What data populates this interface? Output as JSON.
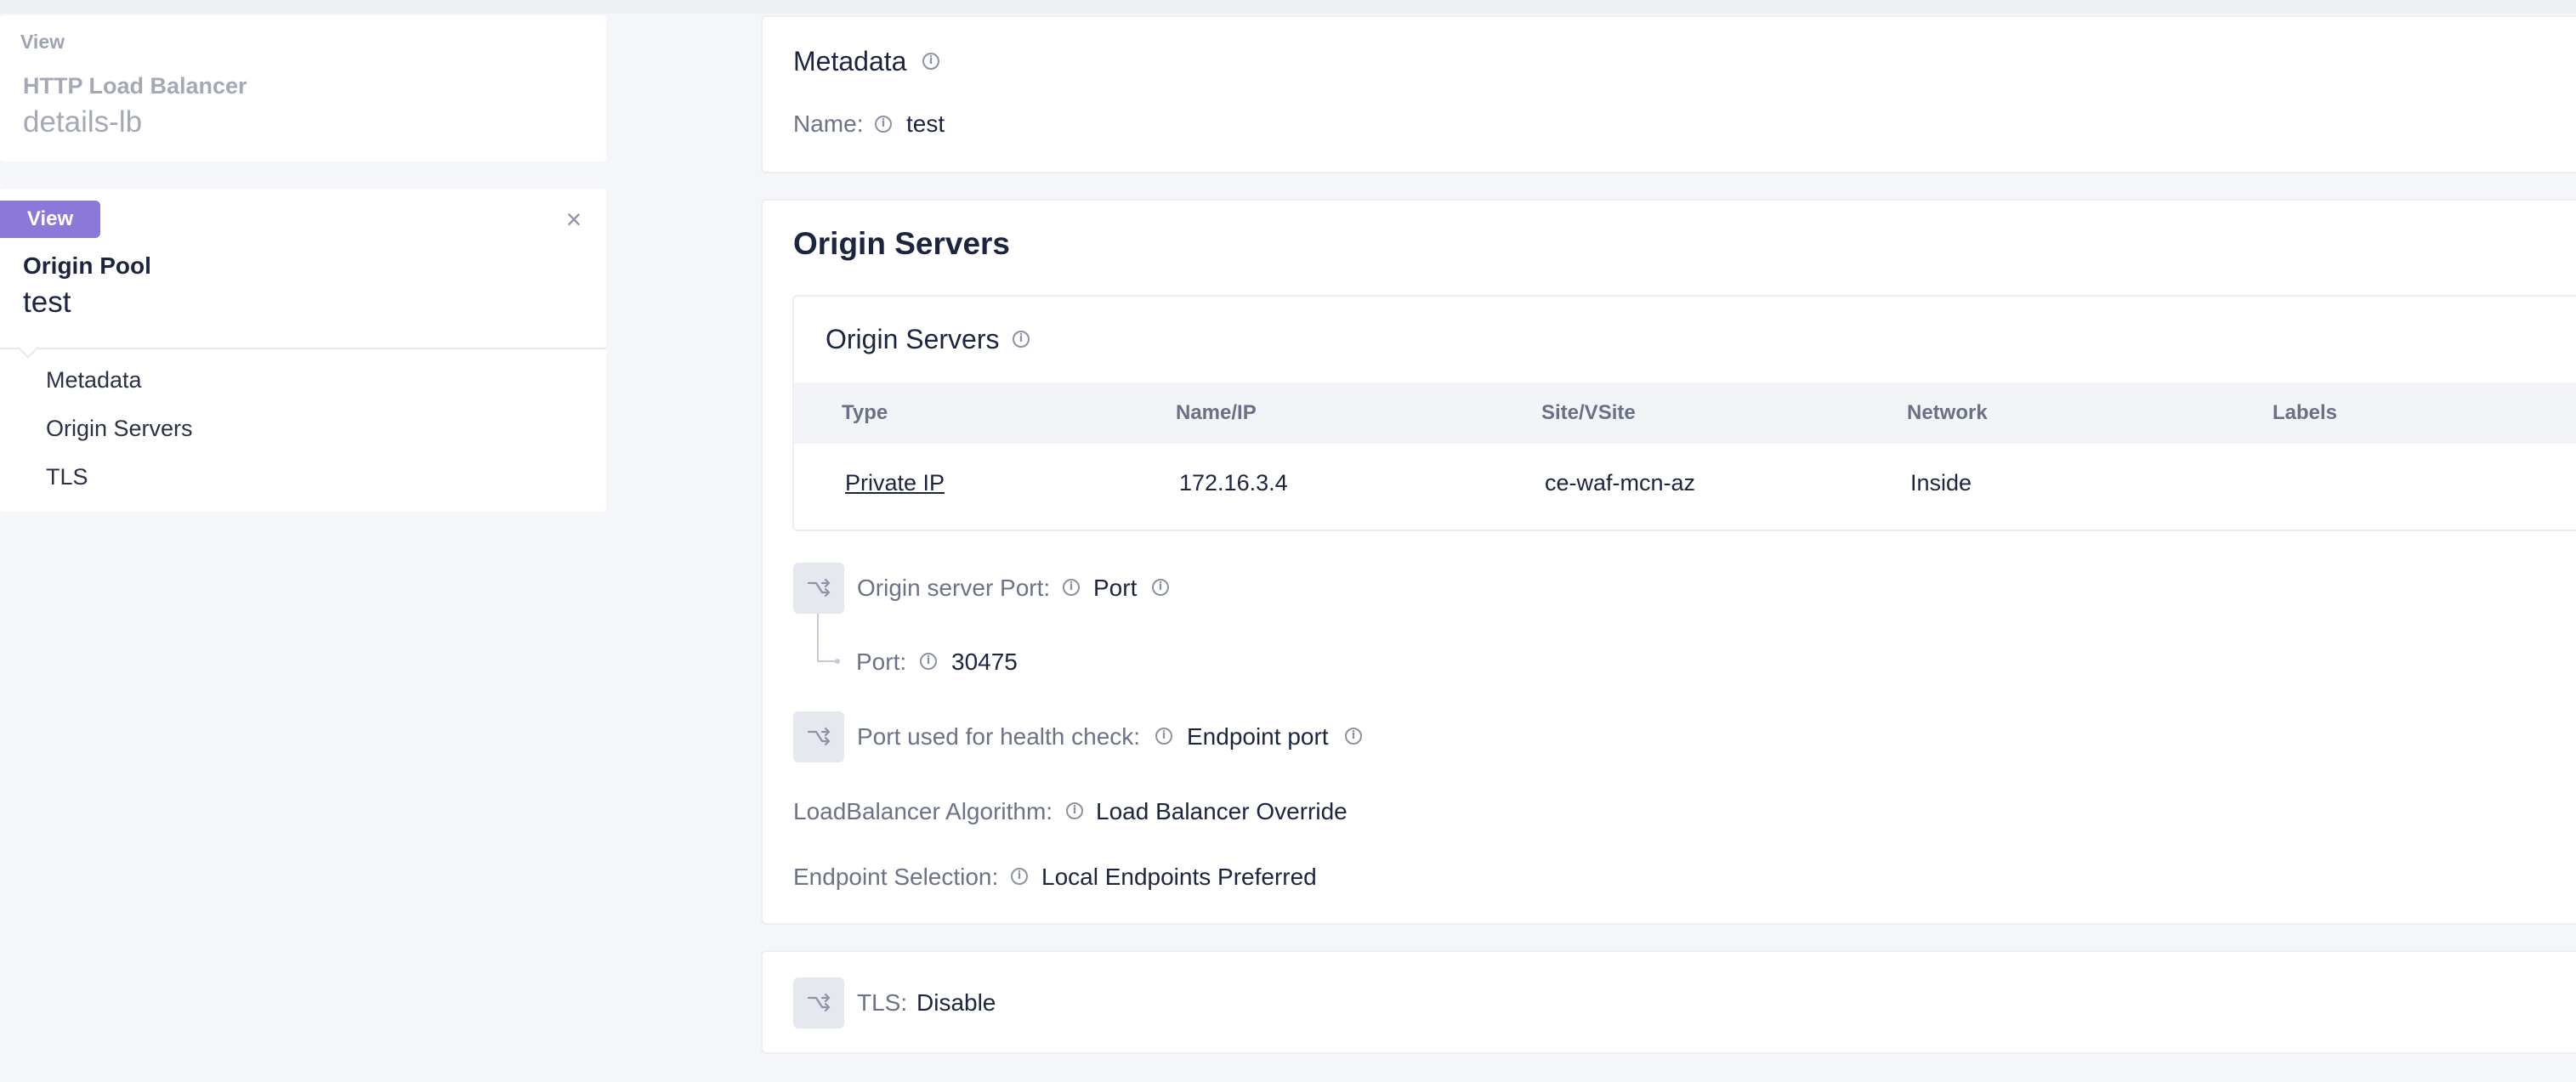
{
  "left": {
    "card1": {
      "view_label": "View",
      "object_type": "HTTP Load Balancer",
      "object_name": "details-lb"
    },
    "card2": {
      "view_badge": "View",
      "close_glyph": "×",
      "object_type": "Origin Pool",
      "object_name": "test",
      "nav": [
        "Metadata",
        "Origin Servers",
        "TLS"
      ]
    }
  },
  "metadata": {
    "title": "Metadata",
    "name_label": "Name:",
    "name_value": "test"
  },
  "origin_servers": {
    "section_title": "Origin Servers",
    "sub_title": "Origin Servers",
    "table": {
      "columns": [
        "Type",
        "Name/IP",
        "Site/VSite",
        "Network",
        "Labels"
      ],
      "rows": [
        {
          "type": "Private IP",
          "name_ip": "172.16.3.4",
          "site": "ce-waf-mcn-az",
          "network": "Inside",
          "labels": ""
        }
      ]
    },
    "origin_port_label": "Origin server Port:",
    "origin_port_value": "Port",
    "port_label": "Port:",
    "port_value": "30475",
    "health_label": "Port used for health check:",
    "health_value": "Endpoint port",
    "lb_algo_label": "LoadBalancer Algorithm:",
    "lb_algo_value": "Load Balancer Override",
    "endpoint_sel_label": "Endpoint Selection:",
    "endpoint_sel_value": "Local Endpoints Preferred"
  },
  "tls": {
    "label": "TLS:",
    "value": "Disable"
  },
  "icons": {
    "info": "info-circle-icon",
    "choice": "split-arrows-icon",
    "close": "close-icon"
  },
  "colors": {
    "accent": "#8b78d8",
    "background": "#f5f6f9",
    "text_primary": "#1c2540",
    "text_secondary": "#6c7287"
  }
}
